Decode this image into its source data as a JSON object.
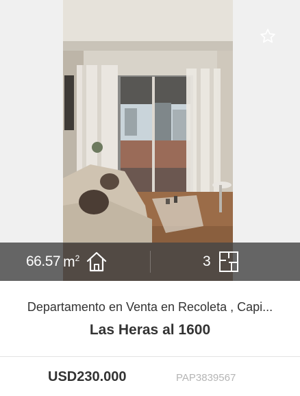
{
  "listing": {
    "area_value": "66.57",
    "area_unit": "m",
    "area_unit_sup": "2",
    "rooms": "3",
    "title": "Departamento en Venta en Recoleta , Capi...",
    "address": "Las Heras al 1600",
    "price": "USD230.000",
    "code": "PAP3839567"
  },
  "icons": {
    "favorite": "star-outline-icon",
    "area": "house-outline-icon",
    "rooms": "floorplan-icon"
  },
  "colors": {
    "stats_bar": "#464646",
    "text_dark": "#333333",
    "code_gray": "#b5b5b5"
  }
}
